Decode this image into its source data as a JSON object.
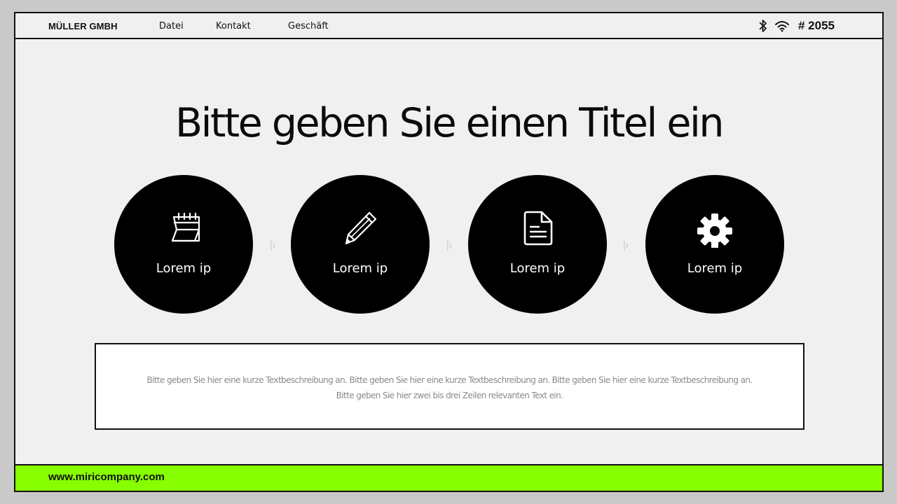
{
  "header": {
    "brand": "MÜLLER GMBH",
    "nav": [
      "Datei",
      "Kontakt",
      "Geschäft"
    ],
    "status": {
      "icons": [
        "bluetooth-icon",
        "wifi-icon"
      ],
      "counter": "# 2055"
    }
  },
  "main": {
    "title": "Bitte geben Sie einen Titel ein",
    "items": [
      {
        "icon": "calendar-icon",
        "label": "Lorem ip"
      },
      {
        "icon": "pencil-icon",
        "label": "Lorem ip"
      },
      {
        "icon": "document-icon",
        "label": "Lorem ip"
      },
      {
        "icon": "gear-icon",
        "label": "Lorem ip"
      }
    ],
    "description": {
      "line1": "Bitte geben Sie hier eine kurze Textbeschreibung an. Bitte geben Sie hier eine kurze Textbeschreibung an. Bitte geben Sie hier eine kurze Textbeschreibung an.",
      "line2": "Bitte geben Sie hier zwei bis drei Zeilen relevanten Text ein."
    }
  },
  "footer": {
    "url": "www.miricompany.com"
  },
  "colors": {
    "accent": "#88ff00",
    "background": "#f0f0f0",
    "outer": "#c9c9c9",
    "ink": "#111111"
  }
}
